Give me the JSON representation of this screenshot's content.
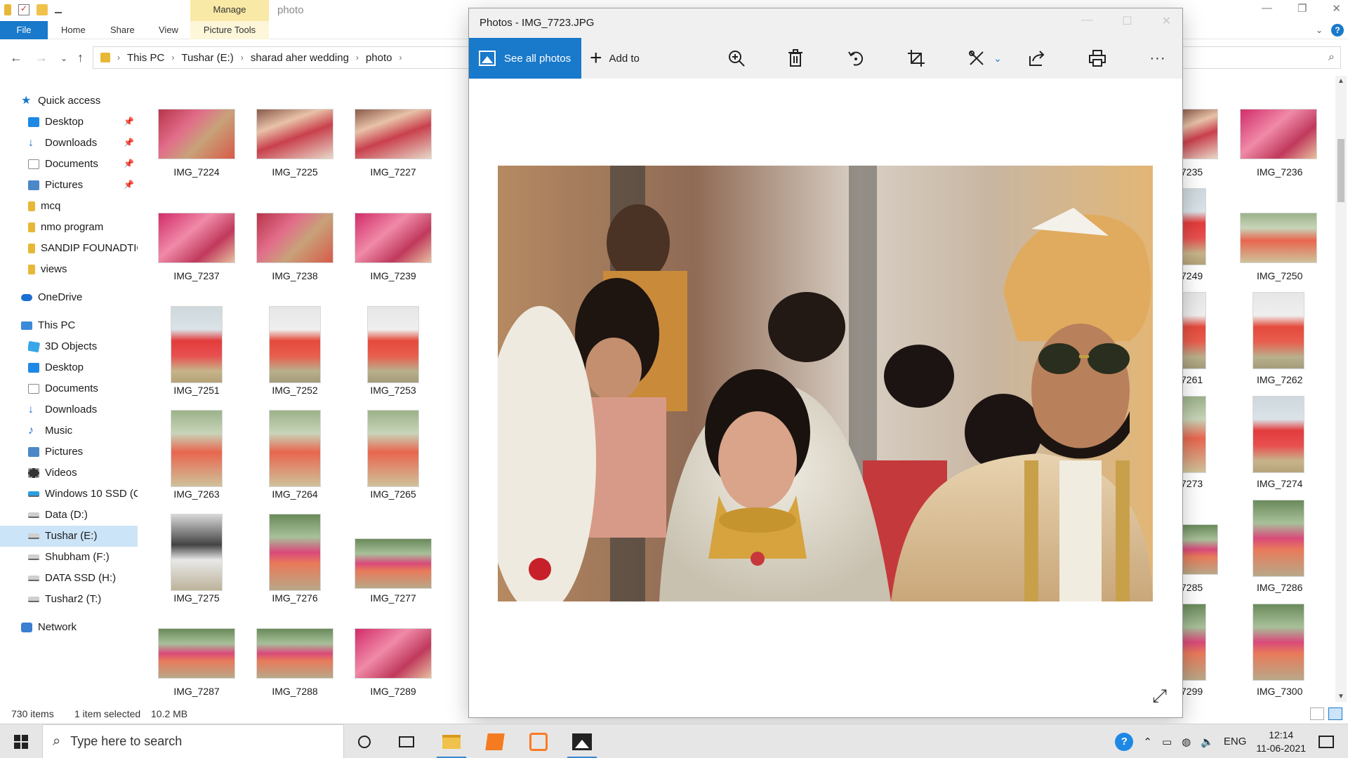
{
  "explorer": {
    "title": "photo",
    "manage_tab": "Manage",
    "ribbon_tabs": {
      "file": "File",
      "home": "Home",
      "share": "Share",
      "view": "View",
      "picture_tools": "Picture Tools"
    },
    "breadcrumb": [
      "This PC",
      "Tushar (E:)",
      "sharad aher wedding",
      "photo"
    ],
    "nav": {
      "quick_access": "Quick access",
      "qa_items": [
        "Desktop",
        "Downloads",
        "Documents",
        "Pictures",
        "mcq",
        "nmo program",
        "SANDIP FOUNADTIO",
        "views"
      ],
      "onedrive": "OneDrive",
      "this_pc": "This PC",
      "pc_items": [
        "3D Objects",
        "Desktop",
        "Documents",
        "Downloads",
        "Music",
        "Pictures",
        "Videos",
        "Windows 10 SSD (C",
        "Data (D:)",
        "Tushar (E:)",
        "Shubham (F:)",
        "DATA SSD (H:)",
        "Tushar2 (T:)"
      ],
      "network": "Network"
    },
    "thumbs": [
      [
        "IMG_7224",
        "IMG_7225",
        "IMG_7227"
      ],
      [
        "IMG_7237",
        "IMG_7238",
        "IMG_7239"
      ],
      [
        "IMG_7251",
        "IMG_7252",
        "IMG_7253"
      ],
      [
        "IMG_7263",
        "IMG_7264",
        "IMG_7265"
      ],
      [
        "IMG_7275",
        "IMG_7276",
        "IMG_7277"
      ],
      [
        "IMG_7287",
        "IMG_7288",
        "IMG_7289"
      ]
    ],
    "right_thumbs": [
      [
        "7235",
        "IMG_7236"
      ],
      [
        "7249",
        "IMG_7250"
      ],
      [
        "7261",
        "IMG_7262"
      ],
      [
        "7273",
        "IMG_7274"
      ],
      [
        "7285",
        "IMG_7286"
      ],
      [
        "7299",
        "IMG_7300"
      ]
    ],
    "status": {
      "items": "730 items",
      "selected": "1 item selected",
      "size": "10.2 MB"
    }
  },
  "photos": {
    "title": "Photos - IMG_7723.JPG",
    "see_all": "See all photos",
    "add_to": "Add to",
    "toolbar_icons": [
      "zoom-in-icon",
      "delete-icon",
      "rotate-icon",
      "crop-icon",
      "edit-icon",
      "share-icon",
      "print-icon",
      "more-icon"
    ]
  },
  "taskbar": {
    "search_placeholder": "Type here to search",
    "language": "ENG",
    "time": "12:14",
    "date": "11-06-2021"
  },
  "colors": {
    "accent": "#1979ca",
    "manage": "#f8e9a6"
  }
}
